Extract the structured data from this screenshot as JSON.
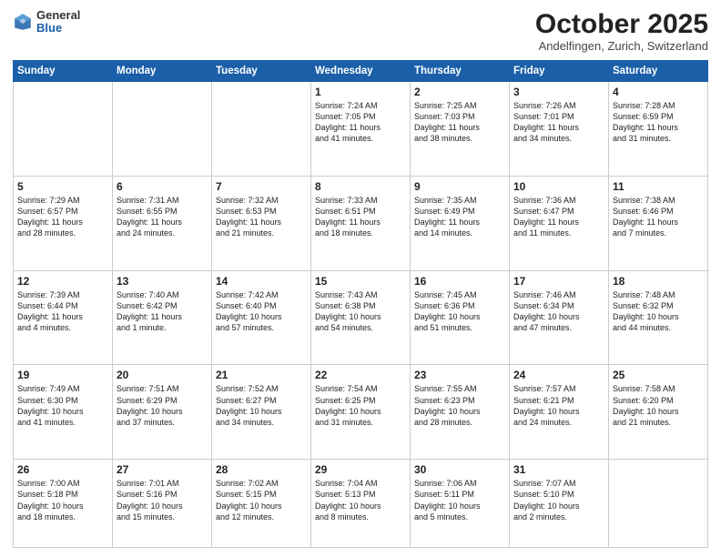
{
  "header": {
    "logo_general": "General",
    "logo_blue": "Blue",
    "month": "October 2025",
    "location": "Andelfingen, Zurich, Switzerland"
  },
  "days_of_week": [
    "Sunday",
    "Monday",
    "Tuesday",
    "Wednesday",
    "Thursday",
    "Friday",
    "Saturday"
  ],
  "weeks": [
    [
      {
        "day": "",
        "info": ""
      },
      {
        "day": "",
        "info": ""
      },
      {
        "day": "",
        "info": ""
      },
      {
        "day": "1",
        "info": "Sunrise: 7:24 AM\nSunset: 7:05 PM\nDaylight: 11 hours\nand 41 minutes."
      },
      {
        "day": "2",
        "info": "Sunrise: 7:25 AM\nSunset: 7:03 PM\nDaylight: 11 hours\nand 38 minutes."
      },
      {
        "day": "3",
        "info": "Sunrise: 7:26 AM\nSunset: 7:01 PM\nDaylight: 11 hours\nand 34 minutes."
      },
      {
        "day": "4",
        "info": "Sunrise: 7:28 AM\nSunset: 6:59 PM\nDaylight: 11 hours\nand 31 minutes."
      }
    ],
    [
      {
        "day": "5",
        "info": "Sunrise: 7:29 AM\nSunset: 6:57 PM\nDaylight: 11 hours\nand 28 minutes."
      },
      {
        "day": "6",
        "info": "Sunrise: 7:31 AM\nSunset: 6:55 PM\nDaylight: 11 hours\nand 24 minutes."
      },
      {
        "day": "7",
        "info": "Sunrise: 7:32 AM\nSunset: 6:53 PM\nDaylight: 11 hours\nand 21 minutes."
      },
      {
        "day": "8",
        "info": "Sunrise: 7:33 AM\nSunset: 6:51 PM\nDaylight: 11 hours\nand 18 minutes."
      },
      {
        "day": "9",
        "info": "Sunrise: 7:35 AM\nSunset: 6:49 PM\nDaylight: 11 hours\nand 14 minutes."
      },
      {
        "day": "10",
        "info": "Sunrise: 7:36 AM\nSunset: 6:47 PM\nDaylight: 11 hours\nand 11 minutes."
      },
      {
        "day": "11",
        "info": "Sunrise: 7:38 AM\nSunset: 6:46 PM\nDaylight: 11 hours\nand 7 minutes."
      }
    ],
    [
      {
        "day": "12",
        "info": "Sunrise: 7:39 AM\nSunset: 6:44 PM\nDaylight: 11 hours\nand 4 minutes."
      },
      {
        "day": "13",
        "info": "Sunrise: 7:40 AM\nSunset: 6:42 PM\nDaylight: 11 hours\nand 1 minute."
      },
      {
        "day": "14",
        "info": "Sunrise: 7:42 AM\nSunset: 6:40 PM\nDaylight: 10 hours\nand 57 minutes."
      },
      {
        "day": "15",
        "info": "Sunrise: 7:43 AM\nSunset: 6:38 PM\nDaylight: 10 hours\nand 54 minutes."
      },
      {
        "day": "16",
        "info": "Sunrise: 7:45 AM\nSunset: 6:36 PM\nDaylight: 10 hours\nand 51 minutes."
      },
      {
        "day": "17",
        "info": "Sunrise: 7:46 AM\nSunset: 6:34 PM\nDaylight: 10 hours\nand 47 minutes."
      },
      {
        "day": "18",
        "info": "Sunrise: 7:48 AM\nSunset: 6:32 PM\nDaylight: 10 hours\nand 44 minutes."
      }
    ],
    [
      {
        "day": "19",
        "info": "Sunrise: 7:49 AM\nSunset: 6:30 PM\nDaylight: 10 hours\nand 41 minutes."
      },
      {
        "day": "20",
        "info": "Sunrise: 7:51 AM\nSunset: 6:29 PM\nDaylight: 10 hours\nand 37 minutes."
      },
      {
        "day": "21",
        "info": "Sunrise: 7:52 AM\nSunset: 6:27 PM\nDaylight: 10 hours\nand 34 minutes."
      },
      {
        "day": "22",
        "info": "Sunrise: 7:54 AM\nSunset: 6:25 PM\nDaylight: 10 hours\nand 31 minutes."
      },
      {
        "day": "23",
        "info": "Sunrise: 7:55 AM\nSunset: 6:23 PM\nDaylight: 10 hours\nand 28 minutes."
      },
      {
        "day": "24",
        "info": "Sunrise: 7:57 AM\nSunset: 6:21 PM\nDaylight: 10 hours\nand 24 minutes."
      },
      {
        "day": "25",
        "info": "Sunrise: 7:58 AM\nSunset: 6:20 PM\nDaylight: 10 hours\nand 21 minutes."
      }
    ],
    [
      {
        "day": "26",
        "info": "Sunrise: 7:00 AM\nSunset: 5:18 PM\nDaylight: 10 hours\nand 18 minutes."
      },
      {
        "day": "27",
        "info": "Sunrise: 7:01 AM\nSunset: 5:16 PM\nDaylight: 10 hours\nand 15 minutes."
      },
      {
        "day": "28",
        "info": "Sunrise: 7:02 AM\nSunset: 5:15 PM\nDaylight: 10 hours\nand 12 minutes."
      },
      {
        "day": "29",
        "info": "Sunrise: 7:04 AM\nSunset: 5:13 PM\nDaylight: 10 hours\nand 8 minutes."
      },
      {
        "day": "30",
        "info": "Sunrise: 7:06 AM\nSunset: 5:11 PM\nDaylight: 10 hours\nand 5 minutes."
      },
      {
        "day": "31",
        "info": "Sunrise: 7:07 AM\nSunset: 5:10 PM\nDaylight: 10 hours\nand 2 minutes."
      },
      {
        "day": "",
        "info": ""
      }
    ]
  ]
}
